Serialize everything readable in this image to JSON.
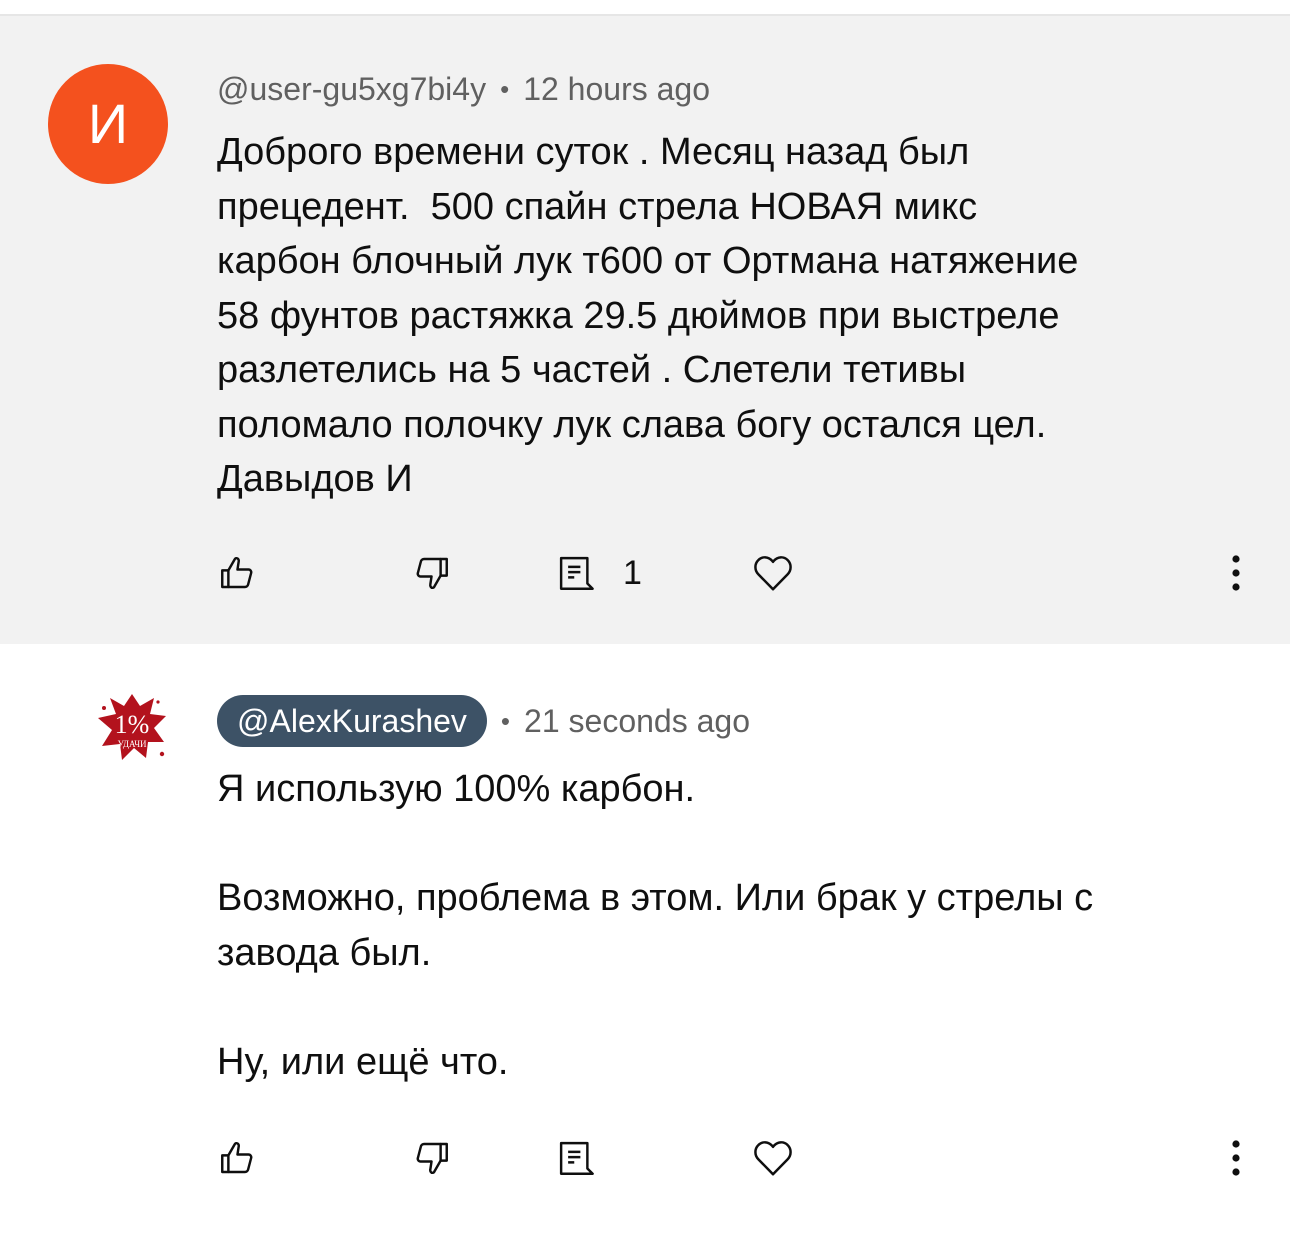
{
  "comments": [
    {
      "avatar_letter": "И",
      "author": "@user-gu5xg7bi4y",
      "separator": "•",
      "time": "12 hours ago",
      "text": "Доброго времени суток . Месяц назад был\nпрецедент.  500 спайн стрела НОВАЯ микс\nкарбон блочный лук т600 от Ортмана натяжение\n58 фунтов растяжка 29.5 дюймов при выстреле\nразлетелись на 5 частей . Слетели тетивы\nполомало полочку лук слава богу остался цел.\nДавыдов И",
      "reply_count": "1",
      "highlighted": true,
      "avatar_color": "#f4511e"
    },
    {
      "avatar_logo_text": "1%",
      "avatar_logo_subtext": "УДАЧИ",
      "author": "@AlexKurashev",
      "separator": "•",
      "time": "21 seconds ago",
      "text": "Я использую 100% карбон.\n\nВозможно, проблема в этом. Или брак у стрелы с\nзавода был.\n\nНу, или ещё что.",
      "reply_count": "",
      "highlighted": false,
      "author_chip_color": "#3d5266"
    }
  ],
  "icons": {
    "like": "thumbs-up-icon",
    "dislike": "thumbs-down-icon",
    "reply": "reply-icon",
    "heart": "heart-icon",
    "more": "more-vertical-icon"
  },
  "colors": {
    "highlight_bg": "#f2f2f2",
    "meta_text": "#606060",
    "body_text": "#0f0f0f"
  }
}
